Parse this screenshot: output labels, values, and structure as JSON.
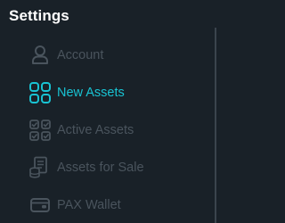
{
  "header": {
    "title": "Settings"
  },
  "colors": {
    "background": "#192128",
    "title": "#ffffff",
    "inactive": "#4a545d",
    "active": "#19c3d3",
    "divider": "#3b444d"
  },
  "menu": {
    "items": [
      {
        "label": "Account",
        "icon": "user-icon",
        "active": false
      },
      {
        "label": "New Assets",
        "icon": "grid-icon",
        "active": true
      },
      {
        "label": "Active Assets",
        "icon": "checklist-grid-icon",
        "active": false
      },
      {
        "label": "Assets for Sale",
        "icon": "document-coins-icon",
        "active": false
      },
      {
        "label": "PAX Wallet",
        "icon": "wallet-icon",
        "active": false
      }
    ]
  }
}
